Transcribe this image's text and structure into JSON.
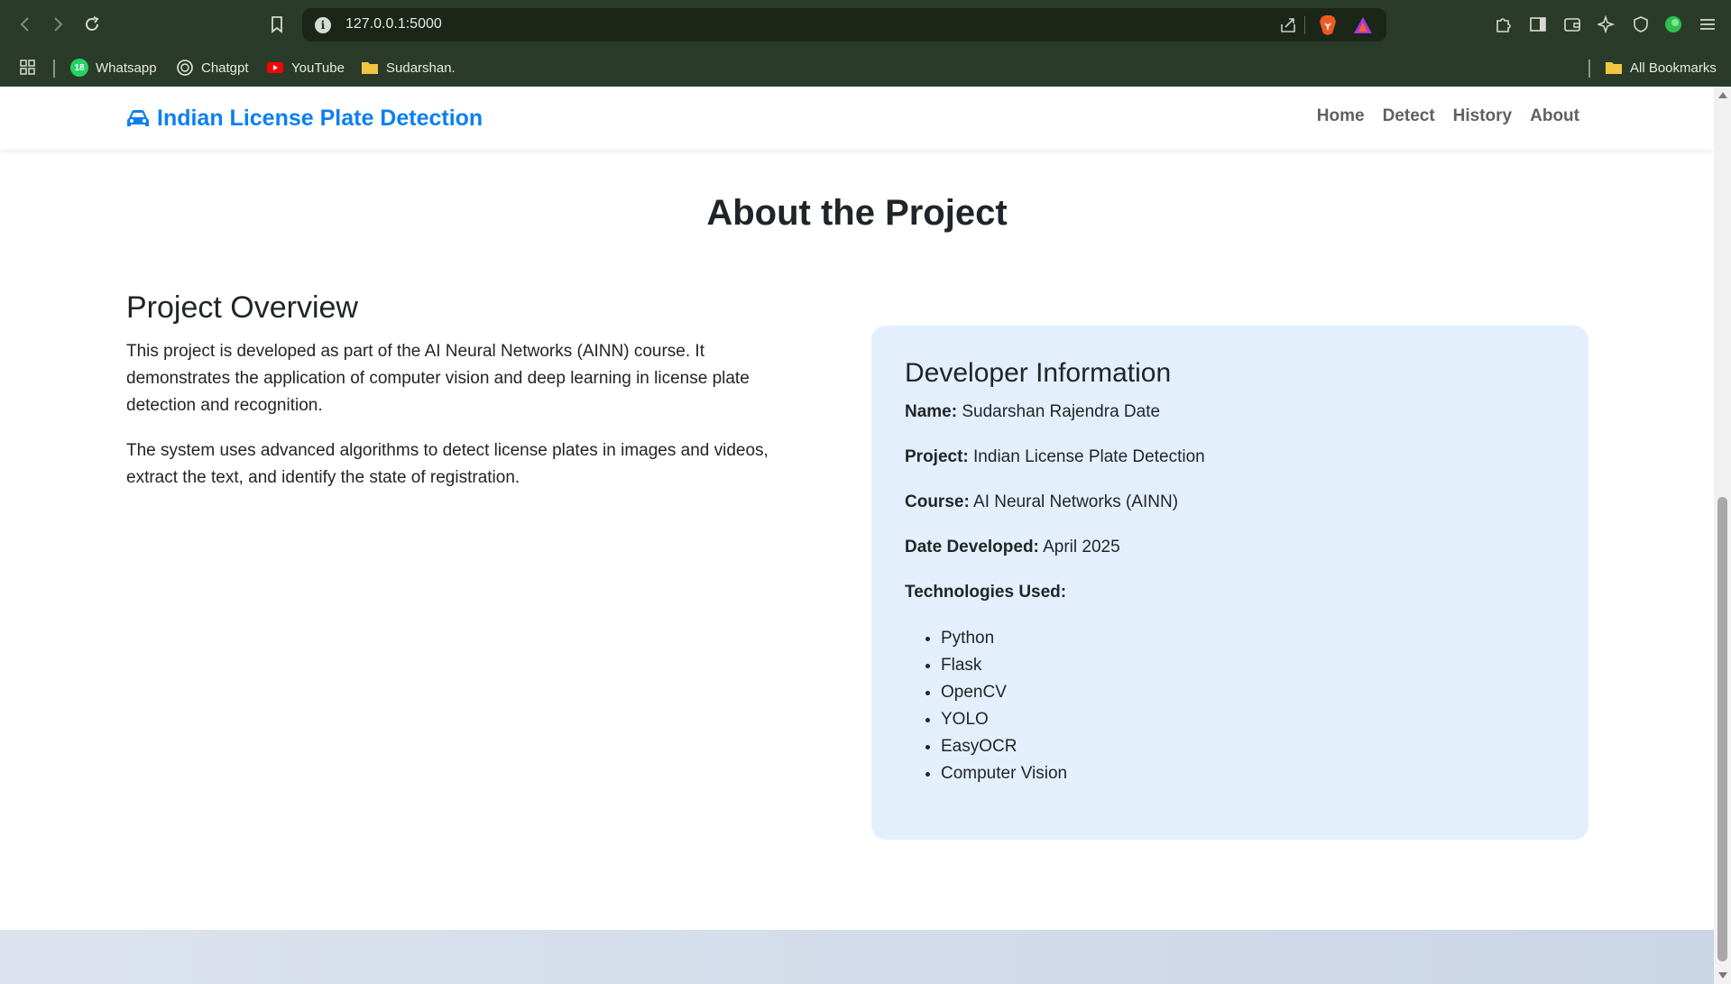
{
  "browser": {
    "url": "127.0.0.1:5000",
    "bookmarks": [
      {
        "label": "Whatsapp",
        "icon": "whatsapp-icon",
        "badge": "18"
      },
      {
        "label": "Chatgpt",
        "icon": "chatgpt-icon"
      },
      {
        "label": "YouTube",
        "icon": "youtube-icon"
      },
      {
        "label": "Sudarshan.",
        "icon": "folder-icon"
      }
    ],
    "all_bookmarks": "All Bookmarks"
  },
  "navbar": {
    "brand": "Indian License Plate Detection",
    "links": [
      "Home",
      "Detect",
      "History",
      "About"
    ]
  },
  "page": {
    "title": "About the Project"
  },
  "overview": {
    "heading": "Project Overview",
    "paragraphs": [
      "This project is developed as part of the AI Neural Networks (AINN) course. It demonstrates the application of computer vision and deep learning in license plate detection and recognition.",
      "The system uses advanced algorithms to detect license plates in images and videos, extract the text, and identify the state of registration."
    ]
  },
  "developer": {
    "heading": "Developer Information",
    "name_label": "Name:",
    "name": "Sudarshan Rajendra Date",
    "project_label": "Project:",
    "project": "Indian License Plate Detection",
    "course_label": "Course:",
    "course": "AI Neural Networks (AINN)",
    "date_label": "Date Developed:",
    "date": "April 2025",
    "tech_label": "Technologies Used:",
    "technologies": [
      "Python",
      "Flask",
      "OpenCV",
      "YOLO",
      "EasyOCR",
      "Computer Vision"
    ]
  },
  "colors": {
    "brand": "#0d7ff0",
    "card_bg": "#e3f0fc",
    "chrome_bg": "#2b3b29"
  }
}
